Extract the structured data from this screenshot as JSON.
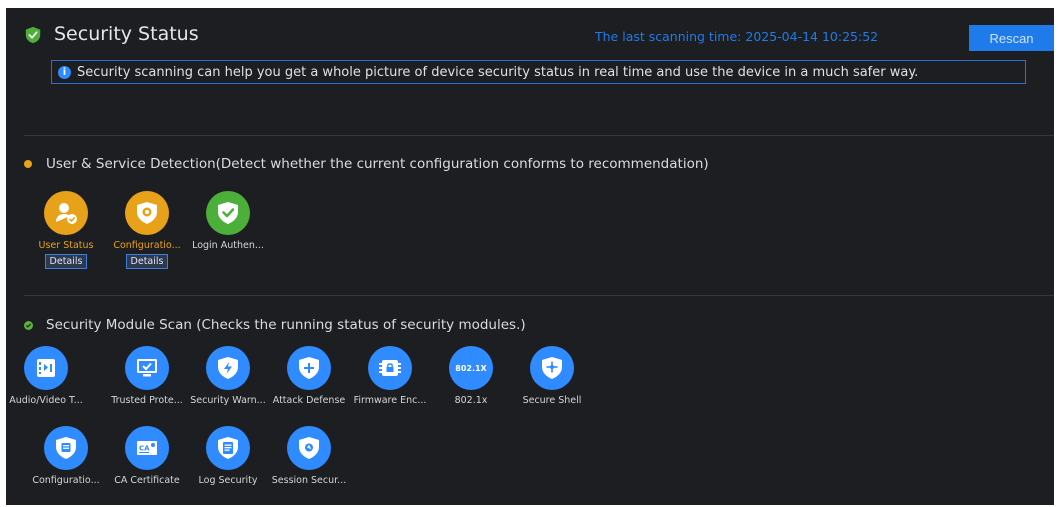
{
  "header": {
    "title": "Security Status",
    "scan_time": "The last scanning time: 2025-04-14 10:25:52",
    "rescan_label": "Rescan",
    "info_text": "Security scanning can help you get a whole picture of device security status in real time and use the device in a much safer way."
  },
  "sections": [
    {
      "title": "User & Service Detection(Detect whether the current configuration conforms to recommendation)",
      "status_color": "#e8a21a",
      "items": [
        {
          "label": "User Status",
          "status": "warning",
          "details": "Details",
          "icon": "user-check-icon"
        },
        {
          "label": "Configuratio...",
          "status": "warning",
          "details": "Details",
          "icon": "config-shield-icon"
        },
        {
          "label": "Login Authen...",
          "status": "ok",
          "icon": "shield-check-icon"
        }
      ]
    },
    {
      "title": "Security Module Scan (Checks the running status of security modules.)",
      "status_color": "#5ab23a",
      "items": [
        {
          "label": "Audio/Video T...",
          "icon": "audio-video-icon"
        },
        {
          "label": "Trusted Prote...",
          "icon": "monitor-check-icon"
        },
        {
          "label": "Security Warn...",
          "icon": "shield-lightning-icon"
        },
        {
          "label": "Attack Defense",
          "icon": "shield-plus-icon"
        },
        {
          "label": "Firmware Enc...",
          "icon": "chip-lock-icon"
        },
        {
          "label": "802.1x",
          "icon": "8021x-icon",
          "icon_text": "802.1X"
        },
        {
          "label": "Secure Shell",
          "icon": "shield-network-icon"
        },
        {
          "label": "Configuratio...",
          "icon": "shield-document-icon"
        },
        {
          "label": "CA Certificate",
          "icon": "certificate-icon",
          "icon_text": "CA"
        },
        {
          "label": "Log Security",
          "icon": "log-document-icon"
        },
        {
          "label": "Session Secur...",
          "icon": "shield-session-icon"
        }
      ]
    }
  ],
  "colors": {
    "accent": "#1f7bea",
    "warning": "#e8a21a",
    "ok": "#5ab23a",
    "module": "#2f8bff",
    "background": "#1c1e21"
  }
}
